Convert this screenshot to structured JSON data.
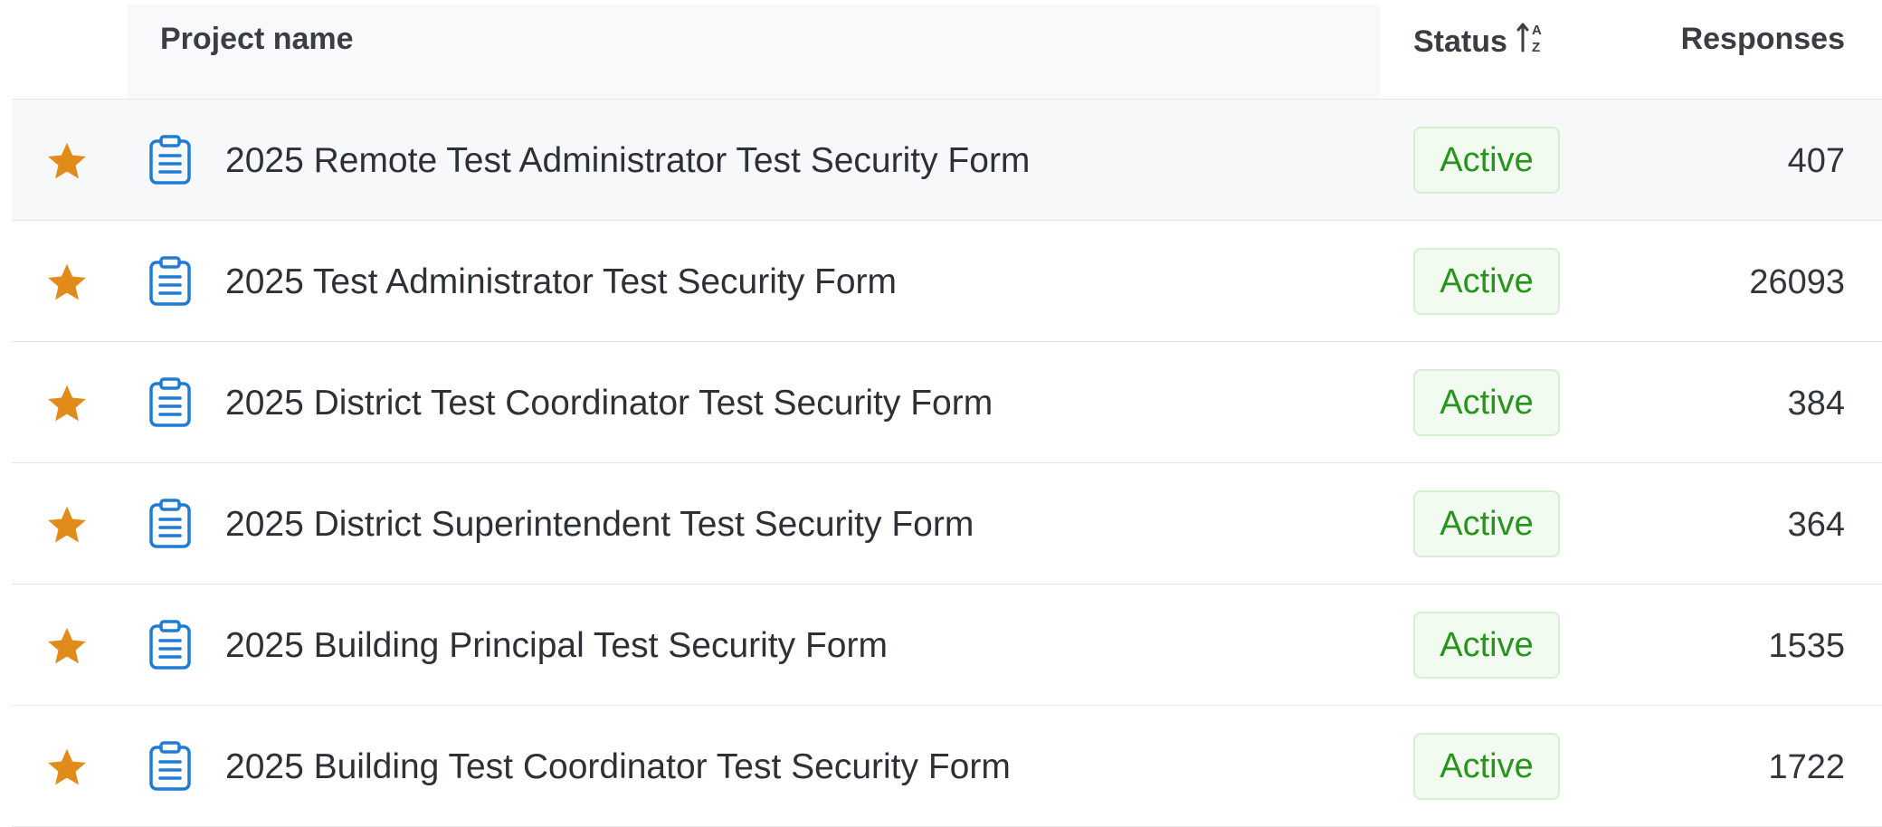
{
  "colors": {
    "star": "#e08b1a",
    "doc_icon": "#1f7bd6",
    "status_text": "#27951c",
    "status_bg": "#f1fbef",
    "status_border": "#d4f0cf"
  },
  "table": {
    "columns": {
      "name": "Project name",
      "status": "Status",
      "responses": "Responses"
    },
    "sort": {
      "column": "status",
      "icon": "sort-ascending-a-z-icon"
    },
    "rows": [
      {
        "name": "2025 Remote Test Administrator Test Security Form",
        "status": "Active",
        "responses": "407",
        "favorite": true,
        "icon": "survey-clipboard-icon"
      },
      {
        "name": "2025 Test Administrator Test Security Form",
        "status": "Active",
        "responses": "26093",
        "favorite": true,
        "icon": "survey-clipboard-icon"
      },
      {
        "name": "2025 District Test Coordinator Test Security Form",
        "status": "Active",
        "responses": "384",
        "favorite": true,
        "icon": "survey-clipboard-icon"
      },
      {
        "name": "2025 District Superintendent Test Security Form",
        "status": "Active",
        "responses": "364",
        "favorite": true,
        "icon": "survey-clipboard-icon"
      },
      {
        "name": "2025 Building Principal Test Security Form",
        "status": "Active",
        "responses": "1535",
        "favorite": true,
        "icon": "survey-clipboard-icon"
      },
      {
        "name": "2025 Building Test Coordinator Test Security Form",
        "status": "Active",
        "responses": "1722",
        "favorite": true,
        "icon": "survey-clipboard-icon"
      }
    ]
  }
}
